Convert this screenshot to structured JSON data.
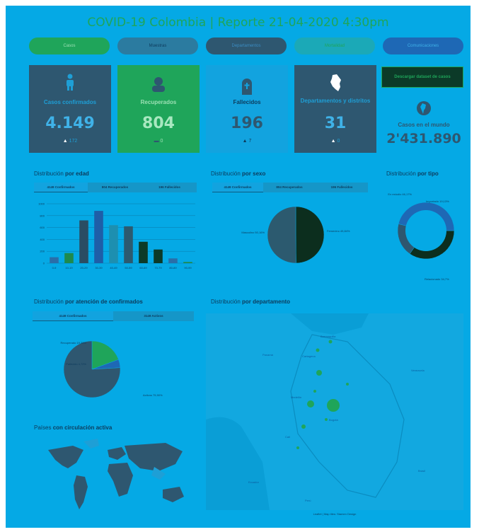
{
  "header": {
    "title": "COVID-19 Colombia | Reporte 21-04-2020 4:30pm"
  },
  "nav": [
    {
      "label": "Casos",
      "bg": "#1fa55a",
      "fg": "#9be0b4"
    },
    {
      "label": "Muestras",
      "bg": "#2b7ba0",
      "fg": "#0d3b5c"
    },
    {
      "label": "Departamentos",
      "bg": "#2e5770",
      "fg": "#3b8cc2"
    },
    {
      "label": "Mortalidad",
      "bg": "#1ba9b7",
      "fg": "#1fa55a"
    },
    {
      "label": "Comunicaciones",
      "bg": "#1e68b5",
      "fg": "#3fb2e8"
    }
  ],
  "cards": {
    "confirmed": {
      "label": "Casos confirmados",
      "value": "4.149",
      "delta": "172"
    },
    "recovered": {
      "label": "Recuperados",
      "value": "804",
      "delta": "0"
    },
    "deaths": {
      "label": "Fallecidos",
      "value": "196",
      "delta": "7"
    },
    "departments": {
      "label": "Departamentos y distritos",
      "value": "31",
      "delta": "0"
    },
    "world": {
      "download": "Descargar dataset de casos",
      "label": "Casos en el mundo",
      "value": "2'431.890"
    }
  },
  "sections": {
    "age": {
      "pre": "Distribución",
      "bold": "por edad",
      "tabs": [
        "4149 Confirmados",
        "804 Recuperados",
        "196 Fallecidos"
      ]
    },
    "sex": {
      "pre": "Distribución",
      "bold": "por sexo",
      "tabs": [
        "4149 Confirmados",
        "804 Recuperados",
        "196 Fallecidos"
      ]
    },
    "type": {
      "pre": "Distribución",
      "bold": "por tipo"
    },
    "attention": {
      "pre": "Distribución",
      "bold": "por atención de confirmados",
      "tabs": [
        "4149 Confirmados",
        "3149 Activos"
      ]
    },
    "department": {
      "pre": "Distribución",
      "bold": "por departamento"
    },
    "countries": {
      "pre": "Países",
      "bold": "con circulación activa"
    }
  },
  "chart_data": [
    {
      "type": "bar",
      "title": "Distribución por edad",
      "categories": [
        "0-9",
        "10-19",
        "20-29",
        "30-39",
        "40-49",
        "50-59",
        "60-69",
        "70-79",
        "80-89",
        "90-99"
      ],
      "values": [
        100,
        170,
        720,
        880,
        640,
        620,
        360,
        230,
        80,
        20
      ],
      "colors": [
        "#2a6ea8",
        "#1e8a4d",
        "#2a4d63",
        "#1e5ea8",
        "#1d8fb0",
        "#2c5a6f",
        "#0c3a28",
        "#0c3a28",
        "#2a6ea8",
        "#1e8a4d"
      ],
      "ylim": [
        0,
        1000
      ],
      "yticks": [
        "1000",
        "800",
        "600",
        "400",
        "200",
        "0"
      ]
    },
    {
      "type": "pie",
      "title": "Distribución por sexo",
      "labels": [
        "Femenino 49,84%",
        "Masculino 50,16%"
      ],
      "values": [
        49.84,
        50.16
      ],
      "colors": [
        "#0c2e1e",
        "#2c5a6f"
      ]
    },
    {
      "type": "pie",
      "title": "Distribución por tipo",
      "labels": [
        "Relacionado 34,7%",
        "Importado 19,13%",
        "En estudio 46,17%"
      ],
      "values": [
        34.7,
        19.13,
        46.17
      ],
      "colors": [
        "#0c2e1e",
        "#2e5770",
        "#1e68b5"
      ]
    },
    {
      "type": "pie",
      "title": "Distribución por atención de confirmados",
      "labels": [
        "Recuperado 19,38%",
        "Fallecido 4,72%",
        "Activos 75,90%"
      ],
      "values": [
        19.38,
        4.72,
        75.9
      ],
      "colors": [
        "#1fa55a",
        "#1e68b5",
        "#2e5770"
      ]
    }
  ],
  "map": {
    "legend": "Leaflet | Map tiles: Stamen Design",
    "labels": [
      "Bogotá",
      "Medellín",
      "Cali",
      "Barranquilla",
      "Cartagena",
      "Venezuela",
      "Panamá",
      "Ecuador",
      "Perú",
      "Brasil"
    ]
  }
}
